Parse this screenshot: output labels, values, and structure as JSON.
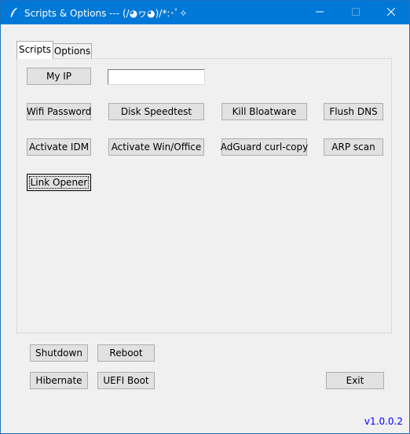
{
  "window": {
    "title": "Scripts & Options --- (/◕ヮ◕)/*:･ﾟ✧",
    "minimize_icon": "minimize-icon",
    "maximize_icon": "maximize-icon",
    "close_icon": "close-icon"
  },
  "tabs": [
    {
      "label": "Scripts",
      "selected": true
    },
    {
      "label": "Options",
      "selected": false
    }
  ],
  "scripts": {
    "my_ip": "My IP",
    "ip_field_value": "",
    "wifi_password": "Wifi Password",
    "disk_speedtest": "Disk Speedtest",
    "kill_bloatware": "Kill Bloatware",
    "flush_dns": "Flush DNS",
    "activate_idm": "Activate IDM",
    "activate_win_office": "Activate Win/Office",
    "adguard_curl_copy": "AdGuard curl-copy",
    "arp_scan": "ARP scan",
    "link_opener": "Link Opener"
  },
  "power": {
    "shutdown": "Shutdown",
    "reboot": "Reboot",
    "hibernate": "Hibernate",
    "uefi_boot": "UEFI Boot",
    "exit": "Exit"
  },
  "version": "v1.0.0.2",
  "colors": {
    "titlebar": "#0078d7",
    "version_text": "#0000ff",
    "button_face": "#e1e1e1"
  }
}
